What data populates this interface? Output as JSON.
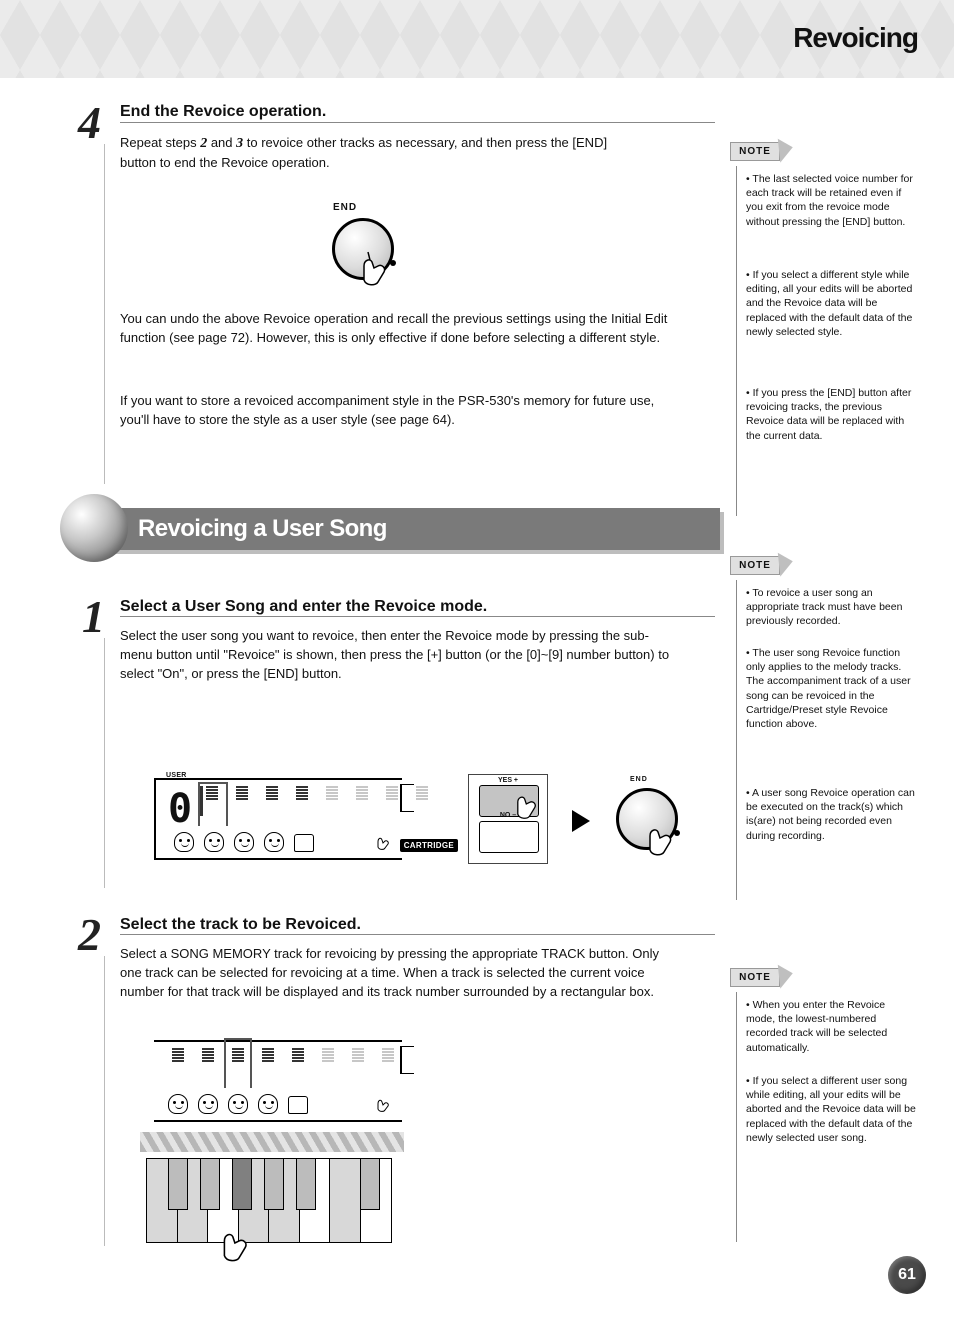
{
  "header": {
    "title": "Revoicing"
  },
  "step4": {
    "number": "4",
    "title": "End the Revoice operation.",
    "body_prefix": "Repeat steps ",
    "body_mid1": "2",
    "body_mid2": " and ",
    "body_mid3": "3",
    "body_suffix": " to revoice other tracks as necessary, and then press the [END] button to end the Revoice operation.",
    "end_label": "END",
    "after_para1": "You can undo the above Revoice operation and recall the previous settings using the Initial Edit function (see page 72). However, this is only effective if done before selecting a different style.",
    "after_para2": "If you want to store a revoiced accompaniment style in the PSR-530's memory for future use, you'll have to store the style as a user style (see page 64)."
  },
  "note1": {
    "tag": "NOTE",
    "lines": [
      "• The last selected voice number for each track will be retained even if you exit from the revoice mode without pressing the [END] button.",
      "• If you select a different style while editing, all your edits will be aborted and the Revoice data will be replaced with the default data of the newly selected style.",
      "• If you press the [END] button after revoicing tracks, the previous Revoice data will be replaced with the current data."
    ]
  },
  "section": {
    "title": "Revoicing a User Song"
  },
  "note2": {
    "tag": "NOTE",
    "lines": [
      "• To revoice a user song an appropriate track must have been previously recorded.",
      "• The user song Revoice function only applies to the melody tracks. The accompaniment track of a user song can be revoiced in the Cartridge/Preset style Revoice function above.",
      "• A user song Revoice operation can be executed on the track(s) which is(are) not being recorded even during recording."
    ]
  },
  "us1": {
    "number": "1",
    "title": "Select a User Song and enter the Revoice mode.",
    "body": "Select the user song you want to revoice, then enter the Revoice mode by pressing the sub-menu button until \"Revoice\" is shown, then press the [+] button (or the [0]~[9] number button) to select \"On\", or press the [END] button.",
    "display": {
      "big_digit": "0",
      "left_small": "USER",
      "cartridge": "CARTRIDGE",
      "tracks": [
        "1",
        "2",
        "3",
        "4",
        "5",
        "6",
        "7",
        "8"
      ]
    },
    "rocker": {
      "top": "YES +",
      "bot": "NO –"
    },
    "end_label": "END"
  },
  "us2": {
    "number": "2",
    "title": "Select the track to be Revoiced.",
    "body": "Select a SONG MEMORY track for revoicing by pressing the appropriate TRACK button. Only one track can be selected for revoicing at a time. When a track is selected the current voice number for that track will be displayed and its track number surrounded by a rectangular box.",
    "display": {
      "tracks": [
        "1",
        "2",
        "3",
        "4",
        "5",
        "6",
        "7",
        "8"
      ],
      "selected_index": 2
    }
  },
  "note3": {
    "tag": "NOTE",
    "lines": [
      "• When you enter the Revoice mode, the lowest-numbered recorded track will be selected automatically.",
      "• If you select a different user song while editing, all your edits will be aborted and the Revoice data will be replaced with the default data of the newly selected user song."
    ]
  },
  "page_number": "61"
}
